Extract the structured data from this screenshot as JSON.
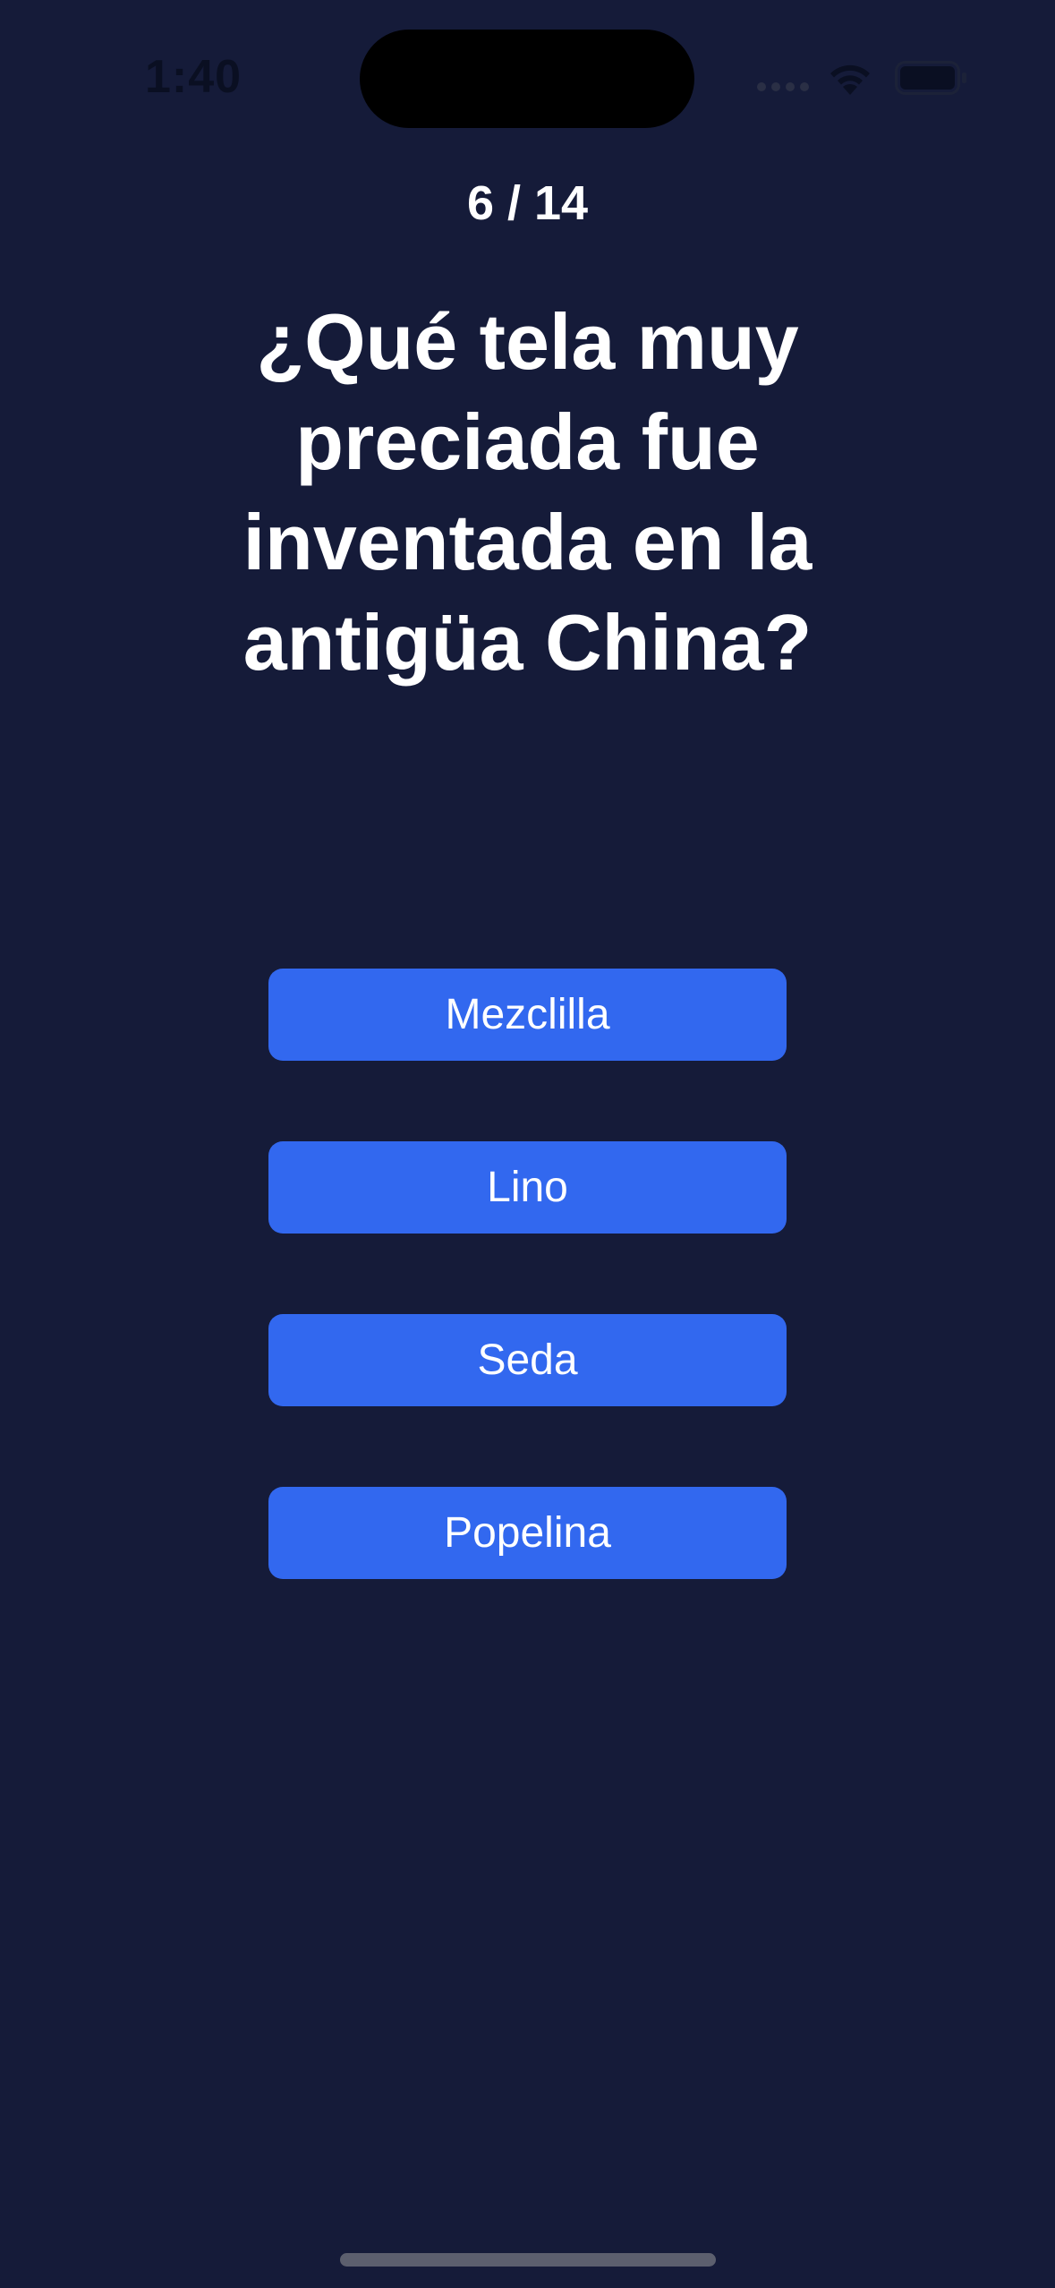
{
  "status_bar": {
    "time": "1:40",
    "icons": [
      "signal-icon",
      "wifi-icon",
      "battery-icon"
    ]
  },
  "quiz": {
    "progress": "6 / 14",
    "question": "¿Qué tela muy preciada fue inventada en la antigüa China?",
    "answers": [
      "Mezclilla",
      "Lino",
      "Seda",
      "Popelina"
    ]
  },
  "colors": {
    "background": "#151b39",
    "button": "#3268ef",
    "text": "#ffffff"
  }
}
